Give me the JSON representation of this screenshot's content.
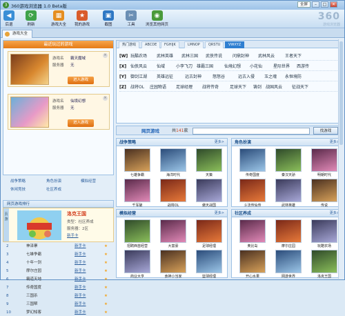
{
  "app": {
    "title": "360游戏浏览器 1.0 Beta版",
    "logo_text": "3",
    "font_size_btn": "全屏"
  },
  "toolbar": {
    "items": [
      {
        "label": "后退",
        "icon": "back-arrow-icon",
        "color": "#3a8fd6",
        "glyph": "◀"
      },
      {
        "label": "刷新",
        "icon": "refresh-icon",
        "color": "#3fa34a",
        "glyph": "⟳"
      },
      {
        "label": "游戏大全",
        "icon": "game-box-icon",
        "color": "#e58e20",
        "glyph": "▦"
      },
      {
        "label": "我的游戏",
        "icon": "my-games-icon",
        "color": "#d95c2b",
        "glyph": "★"
      },
      {
        "label": "截图",
        "icon": "screenshot-icon",
        "color": "#2f78c4",
        "glyph": "▣"
      },
      {
        "label": "工具",
        "icon": "tools-icon",
        "color": "#6b8fb4",
        "glyph": "✂"
      },
      {
        "label": "浏览其他网页",
        "icon": "browse-web-icon",
        "color": "#4a9a3a",
        "glyph": "◉"
      }
    ],
    "brand_big": "360",
    "brand_small": "游戏浏览器"
  },
  "tab": {
    "label": "游戏大全"
  },
  "recent": {
    "header": "最近玩过的游戏",
    "cards": [
      {
        "game_label": "游戏名",
        "game": "霸天魔域",
        "server_label": "服务器",
        "server": "无",
        "enter": "进入游戏"
      },
      {
        "game_label": "游戏名",
        "game": "仙境幻想",
        "server_label": "服务器",
        "server": "无",
        "enter": "进入游戏"
      }
    ]
  },
  "categories": [
    "战争策略",
    "角色扮演",
    "模拟经营",
    "休闲竞技",
    "社区养成"
  ],
  "ranking": {
    "header": "网页游戏排行",
    "featured": {
      "name": "洛克王国",
      "type": "类型：社区养成",
      "server": "服务器：2区",
      "link": "新手卡",
      "side": "页游"
    },
    "rows": [
      {
        "num": "2",
        "name": "神泽寨",
        "link": "新手卡"
      },
      {
        "num": "3",
        "name": "七雄争霸",
        "link": "新手卡"
      },
      {
        "num": "4",
        "name": "十年一剑",
        "link": "新手卡"
      },
      {
        "num": "5",
        "name": "摩尔庄园",
        "link": "新手卡"
      },
      {
        "num": "6",
        "name": "霸道天地",
        "link": "新手卡"
      },
      {
        "num": "7",
        "name": "传奇国度",
        "link": "新手卡"
      },
      {
        "num": "8",
        "name": "三国杀",
        "link": "新手卡"
      },
      {
        "num": "9",
        "name": "三国帮",
        "link": "新手卡"
      },
      {
        "num": "10",
        "name": "梦幻知客",
        "link": "新手卡"
      }
    ]
  },
  "hot": {
    "tabs": [
      "热门游戏",
      "ABCDE",
      "FGHIJK",
      "LMNOP",
      "QRSTU",
      "VWXYZ"
    ],
    "active_tab": 5,
    "rows": [
      {
        "letter": "[W]",
        "words": [
          "玩酷农场",
          "武林英雄",
          "武林三国",
          "武侠传说",
          "问鼎封神",
          "武林风云",
          "王者天下"
        ]
      },
      {
        "letter": "[X]",
        "words": [
          "仙侠风云",
          "仙域",
          "小李飞刀",
          "雄霸三国",
          "仙境幻想",
          "小花仙",
          "星际世界",
          "西游传"
        ]
      },
      {
        "letter": "[Y]",
        "words": [
          "御剑江湖",
          "英雄远征",
          "远古封神",
          "怒怒谷",
          "远古入侵",
          "玉之魂",
          "永恒境防"
        ]
      },
      {
        "letter": "[Z]",
        "words": [
          "战将OL",
          "庄园物语",
          "足球经理",
          "战将传奇",
          "足球天下",
          "铸剑",
          "战国风云",
          "征战天下"
        ]
      }
    ]
  },
  "web_games": {
    "label": "网页游戏",
    "count_prefix": "共",
    "count": "141",
    "count_suffix": "款",
    "search_btn": "找游戏"
  },
  "sections": [
    {
      "title": "战争策略",
      "more": "更多>",
      "games": [
        "七雄争霸",
        "海洋时代",
        "天策",
        "千军破",
        "战将OL",
        "傲天战国"
      ]
    },
    {
      "title": "角色扮演",
      "more": "更多>",
      "games": [
        "传奇国度",
        "秦汉天骄",
        "明朝时代",
        "斗法传仙传",
        "武林英雄",
        "传说"
      ]
    },
    {
      "title": "模拟经营",
      "more": "更多>",
      "games": [
        "招聘西苗经营",
        "大富豪",
        "足球经理",
        "商业大亨",
        "食神小当家",
        "篮球经理"
      ]
    },
    {
      "title": "社区养成",
      "more": "更多>",
      "games": [
        "奥比岛",
        "摩尔庄园",
        "玩酷农场",
        "开心水果",
        "网游世界",
        "洛克王国"
      ]
    }
  ],
  "colors": {
    "accent": "#2f7fd1",
    "orange": "#e57b16"
  }
}
